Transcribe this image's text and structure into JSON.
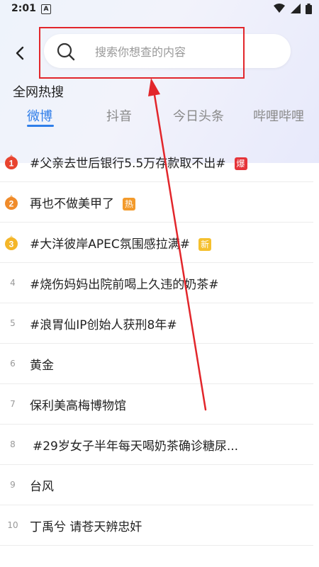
{
  "status": {
    "time": "2:01"
  },
  "search": {
    "placeholder": "搜索你想查的内容"
  },
  "section_title": "全网热搜",
  "tabs": [
    {
      "label": "微博",
      "active": true
    },
    {
      "label": "抖音",
      "active": false
    },
    {
      "label": "今日头条",
      "active": false
    },
    {
      "label": "哔哩哔哩",
      "active": false
    }
  ],
  "hot_list": [
    {
      "rank": "1",
      "title": "#父亲去世后银行5.5万存款取不出#",
      "badge": "爆",
      "badge_color": "#e5343a",
      "medal_color": "#e8432f"
    },
    {
      "rank": "2",
      "title": "再也不做美甲了",
      "badge": "热",
      "badge_color": "#f39a2b",
      "medal_color": "#f08b2a"
    },
    {
      "rank": "3",
      "title": "#大洋彼岸APEC氛围感拉满#",
      "badge": "新",
      "badge_color": "#f5c02e",
      "medal_color": "#f4b629"
    },
    {
      "rank": "4",
      "title": "#烧伤妈妈出院前喝上久违的奶茶#"
    },
    {
      "rank": "5",
      "title": "#浪胃仙IP创始人获刑8年#"
    },
    {
      "rank": "6",
      "title": "黄金"
    },
    {
      "rank": "7",
      "title": "保利美高梅博物馆"
    },
    {
      "rank": "8",
      "title": "#29岁女子半年每天喝奶茶确诊糖尿..."
    },
    {
      "rank": "9",
      "title": "台风"
    },
    {
      "rank": "10",
      "title": "丁禹兮 请苍天辨忠奸"
    }
  ],
  "colors": {
    "accent": "#2f7ee9",
    "annotation": "#e2262b"
  }
}
